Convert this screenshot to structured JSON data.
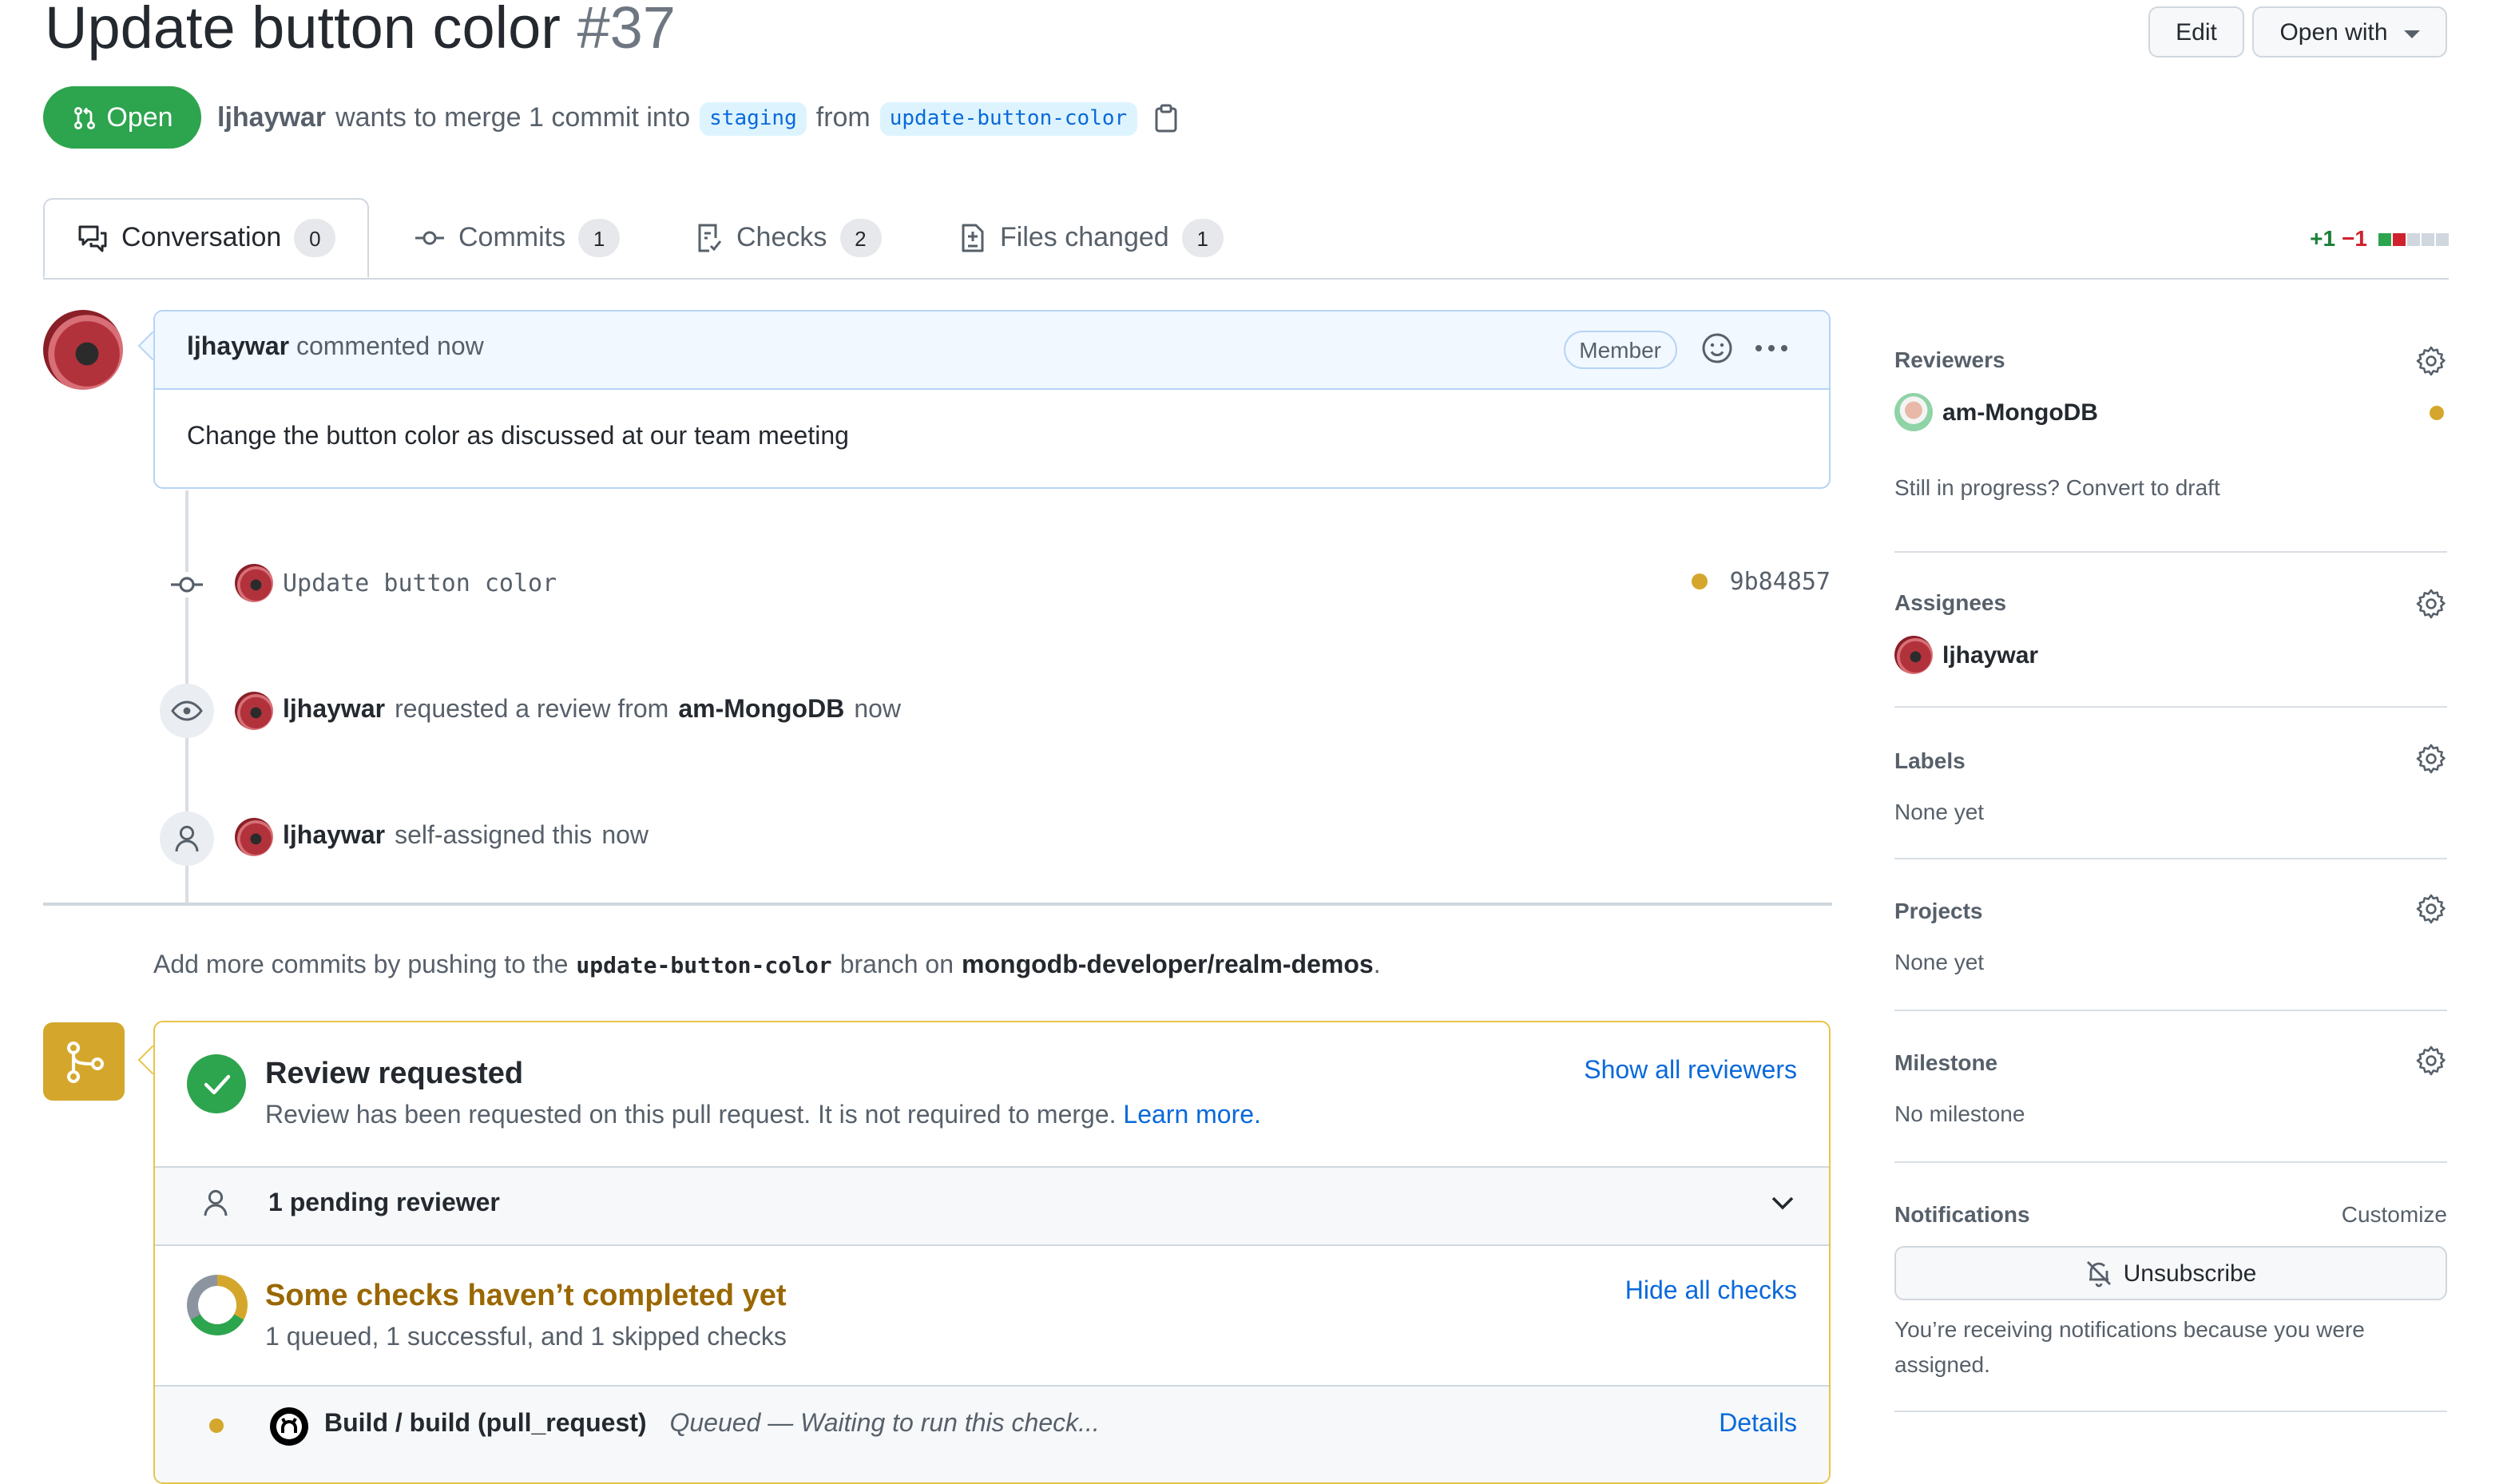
{
  "header": {
    "title": "Update button color",
    "number": "#37",
    "edit_label": "Edit",
    "open_with_label": "Open with",
    "state": "Open",
    "author": "ljhaywar",
    "merge_text": "wants to merge 1 commit into",
    "base_branch": "staging",
    "from_text": "from",
    "head_branch": "update-button-color"
  },
  "tabs": [
    {
      "label": "Conversation",
      "count": "0",
      "icon": "comment-discussion-icon",
      "active": true
    },
    {
      "label": "Commits",
      "count": "1",
      "icon": "git-commit-icon"
    },
    {
      "label": "Checks",
      "count": "2",
      "icon": "checklist-icon"
    },
    {
      "label": "Files changed",
      "count": "1",
      "icon": "file-diff-icon"
    }
  ],
  "diffstat": {
    "additions": "+1",
    "deletions": "−1",
    "colors": {
      "add": "#2da44e",
      "del": "#cf222e",
      "neutral": "#d0d7de"
    }
  },
  "comment": {
    "author": "ljhaywar",
    "action": "commented now",
    "role_badge": "Member",
    "body": "Change the button color as discussed at our team meeting"
  },
  "timeline": [
    {
      "type": "commit",
      "message": "Update button color",
      "sha": "9b84857",
      "status_color": "#d4a72c"
    },
    {
      "type": "review_requested",
      "actor": "ljhaywar",
      "text": "requested a review from",
      "target": "am-MongoDB",
      "time": "now"
    },
    {
      "type": "assigned",
      "actor": "ljhaywar",
      "text": "self-assigned this",
      "time": "now"
    }
  ],
  "push_hint": {
    "prefix": "Add more commits by pushing to the",
    "branch": "update-button-color",
    "middle": "branch on",
    "repo": "mongodb-developer/realm-demos",
    "suffix": "."
  },
  "merge_box": {
    "review_title": "Review requested",
    "review_desc": "Review has been requested on this pull request. It is not required to merge.",
    "learn_more": "Learn more.",
    "show_all_reviewers": "Show all reviewers",
    "pending_reviewers": "1 pending reviewer",
    "checks_title": "Some checks haven’t completed yet",
    "checks_summary": "1 queued, 1 successful, and 1 skipped checks",
    "hide_all_checks": "Hide all checks",
    "check_row": {
      "name": "Build / build (pull_request)",
      "status": "Queued — Waiting to run this check...",
      "details": "Details"
    }
  },
  "sidebar": {
    "reviewers": {
      "title": "Reviewers",
      "user": "am-MongoDB",
      "draft_hint": "Still in progress? Convert to draft"
    },
    "assignees": {
      "title": "Assignees",
      "user": "ljhaywar"
    },
    "labels": {
      "title": "Labels",
      "value": "None yet"
    },
    "projects": {
      "title": "Projects",
      "value": "None yet"
    },
    "milestone": {
      "title": "Milestone",
      "value": "No milestone"
    },
    "notifications": {
      "title": "Notifications",
      "customize": "Customize",
      "unsubscribe": "Unsubscribe",
      "reason": "You’re receiving notifications because you were assigned."
    }
  }
}
